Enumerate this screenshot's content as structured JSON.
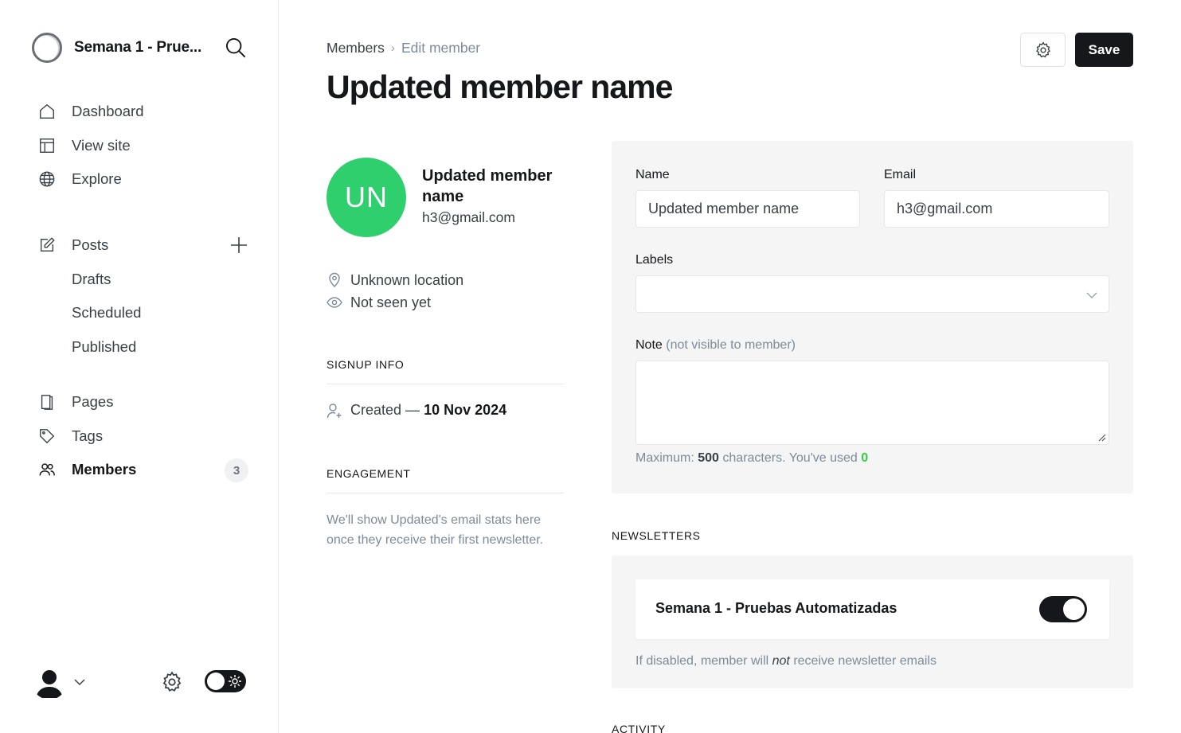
{
  "sidebar": {
    "site_title": "Semana 1 - Prue...",
    "nav_primary": [
      {
        "label": "Dashboard",
        "icon": "home-icon"
      },
      {
        "label": "View site",
        "icon": "layout-icon"
      },
      {
        "label": "Explore",
        "icon": "globe-icon"
      }
    ],
    "posts": {
      "label": "Posts",
      "icon": "edit-icon"
    },
    "posts_sub": [
      "Drafts",
      "Scheduled",
      "Published"
    ],
    "nav_secondary": [
      {
        "label": "Pages",
        "icon": "page-icon"
      },
      {
        "label": "Tags",
        "icon": "tag-icon"
      }
    ],
    "members": {
      "label": "Members",
      "icon": "users-icon",
      "count": "3"
    }
  },
  "header": {
    "breadcrumb_parent": "Members",
    "breadcrumb_current": "Edit member",
    "title": "Updated member name",
    "save_label": "Save"
  },
  "member": {
    "initials": "UN",
    "name": "Updated member name",
    "email": "h3@gmail.com",
    "location": "Unknown location",
    "seen": "Not seen yet",
    "signup_heading": "SIGNUP INFO",
    "created_label": "Created —",
    "created_date": "10 Nov 2024",
    "engagement_heading": "ENGAGEMENT",
    "engagement_text": "We'll show Updated's email stats here once they receive their first newsletter.",
    "avatar_color": "#30cf6e"
  },
  "form": {
    "name_label": "Name",
    "name_value": "Updated member name",
    "email_label": "Email",
    "email_value": "h3@gmail.com",
    "labels_label": "Labels",
    "labels_value": "",
    "note_label": "Note",
    "note_hint": "(not visible to member)",
    "note_value": "",
    "max_prefix": "Maximum:",
    "max_value": "500",
    "max_middle": "characters. You've used",
    "used_value": "0"
  },
  "newsletters": {
    "heading": "NEWSLETTERS",
    "items": [
      {
        "name": "Semana 1 - Pruebas Automatizadas",
        "enabled": true
      }
    ],
    "note_prefix": "If disabled, member will",
    "note_em": "not",
    "note_suffix": "receive newsletter emails"
  },
  "activity_heading": "ACTIVITY",
  "colors": {
    "accent_dark": "#15171a",
    "green": "#30cf43"
  }
}
